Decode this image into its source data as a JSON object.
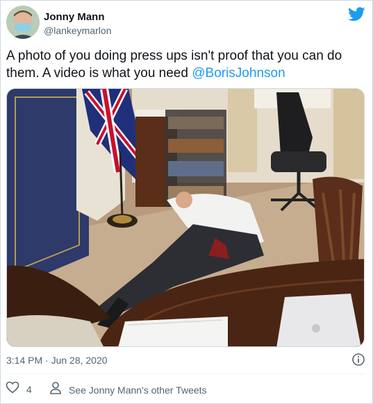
{
  "author": {
    "name": "Jonny Mann",
    "handle": "@lankeymarlon"
  },
  "tweet": {
    "text_part1": "A photo of you doing press ups isn't proof that you can do them. A video is what you need ",
    "mention": "@BorisJohnson"
  },
  "meta": {
    "timestamp": "3:14 PM · Jun 28, 2020",
    "like_count": "4",
    "other_tweets": "See Jonny Mann's other Tweets"
  },
  "colors": {
    "accent": "#1d9bf0",
    "text": "#0f1419",
    "secondary": "#536471"
  },
  "icons": [
    "avatar",
    "twitter-bird-icon",
    "info-icon",
    "heart-icon",
    "person-icon"
  ]
}
